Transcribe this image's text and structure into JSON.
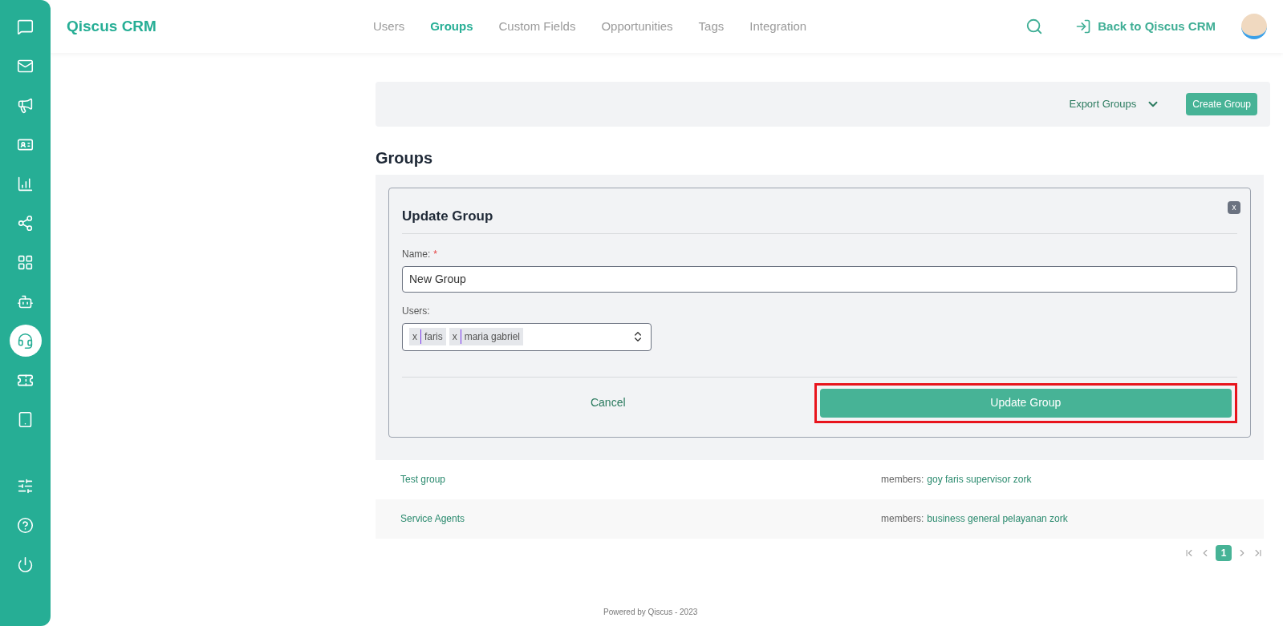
{
  "sidebar": {
    "top_items": [
      {
        "selected": false
      },
      {
        "selected": false
      },
      {
        "selected": false
      },
      {
        "selected": false
      },
      {
        "selected": false
      },
      {
        "selected": false
      },
      {
        "selected": false
      },
      {
        "selected": false
      },
      {
        "selected": true
      },
      {
        "selected": false
      },
      {
        "selected": false
      }
    ],
    "bottom_items": [
      {
        "selected": false
      },
      {
        "selected": false
      },
      {
        "selected": false
      }
    ]
  },
  "header": {
    "logo": "Qiscus CRM",
    "nav": [
      {
        "label": "Users",
        "selected": false
      },
      {
        "label": "Groups",
        "selected": true
      },
      {
        "label": "Custom Fields",
        "selected": false
      },
      {
        "label": "Opportunities",
        "selected": false
      },
      {
        "label": "Tags",
        "selected": false
      },
      {
        "label": "Integration",
        "selected": false
      }
    ],
    "back_link": "Back to Qiscus CRM"
  },
  "toolbar": {
    "export": "Export Groups",
    "create": "Create Group"
  },
  "page_title": "Groups",
  "dialog": {
    "title": "Update Group",
    "close": "x",
    "name_label": "Name:",
    "required_mark": "*",
    "name_value": "New Group",
    "users_label": "Users:",
    "users": [
      {
        "remove": "x",
        "name": "faris"
      },
      {
        "remove": "x",
        "name": "maria gabriel"
      }
    ],
    "cancel": "Cancel",
    "submit": {
      "label": "Update Group",
      "highlighted": true
    }
  },
  "groups": [
    {
      "name": "Test group",
      "members_label": "members:",
      "members": "goy faris supervisor zork"
    },
    {
      "name": "Service Agents",
      "members_label": "members:",
      "members": "business general pelayanan zork"
    }
  ],
  "pagination": {
    "pages": [
      {
        "label": "1",
        "selected": true
      }
    ]
  },
  "footer": "Powered by Qiscus - 2023"
}
